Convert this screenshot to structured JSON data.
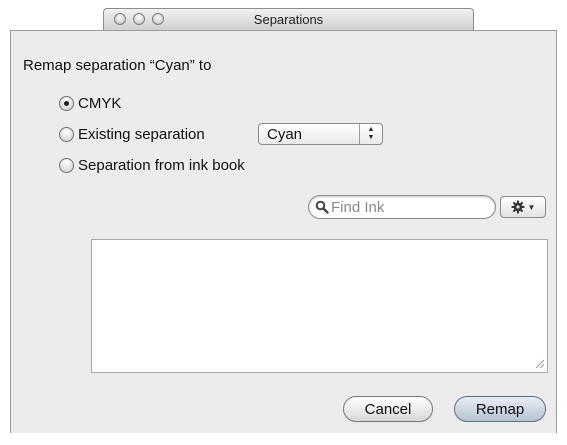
{
  "window": {
    "title": "Separations"
  },
  "dialog": {
    "heading": "Remap separation “Cyan” to",
    "options": [
      {
        "label": "CMYK",
        "selected": true
      },
      {
        "label": "Existing separation",
        "selected": false
      },
      {
        "label": "Separation from ink book",
        "selected": false
      }
    ],
    "separation_select": {
      "value": "Cyan"
    },
    "search": {
      "placeholder": "Find Ink",
      "value": ""
    },
    "action_menu": {
      "icon": "gear-icon"
    },
    "ink_list": {
      "items": []
    },
    "buttons": {
      "cancel": "Cancel",
      "remap": "Remap"
    }
  },
  "colors": {
    "panel_bg": "#ececec",
    "default_button": "#b7c2d1"
  }
}
